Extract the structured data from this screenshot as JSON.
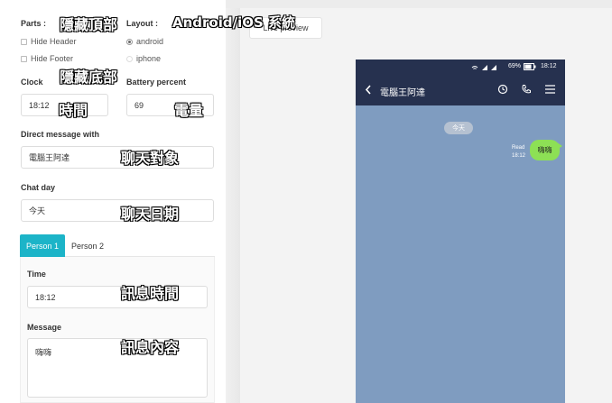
{
  "settings": {
    "parts_label": "Parts :",
    "hide_header": "Hide Header",
    "hide_footer": "Hide Footer",
    "layout_label": "Layout :",
    "layout_android": "android",
    "layout_iphone": "iphone",
    "clock_label": "Clock",
    "clock_value": "18:12",
    "battery_label": "Battery percent",
    "battery_value": "69",
    "dm_label": "Direct message with",
    "dm_value": "電腦王阿達",
    "chat_day_label": "Chat day",
    "chat_day_value": "今天",
    "tabs": [
      "Person 1",
      "Person 2"
    ],
    "time_label": "Time",
    "time_value": "18:12",
    "message_label": "Message",
    "message_value": "嗨嗨"
  },
  "preview": {
    "button_label": "Live preview",
    "phone": {
      "battery_pct": "69%",
      "clock": "18:12",
      "contact_name": "電腦王阿達",
      "day_pill": "今天",
      "read_label": "Read",
      "read_time": "18:12",
      "bubble_text": "嗨嗨"
    }
  },
  "annotations": {
    "hide_header": "隱藏頂部",
    "layout": "Android/iOS 系統",
    "hide_footer": "隱藏底部",
    "clock": "時間",
    "battery": "電量",
    "dm": "聊天對象",
    "chat_day": "聊天日期",
    "msg_time": "訊息時間",
    "msg_content": "訊息內容"
  },
  "colors": {
    "accent_tab": "#1cb4c8",
    "phone_header": "#26314f",
    "chat_bg": "#7f9cc0",
    "bubble": "#8de055"
  }
}
